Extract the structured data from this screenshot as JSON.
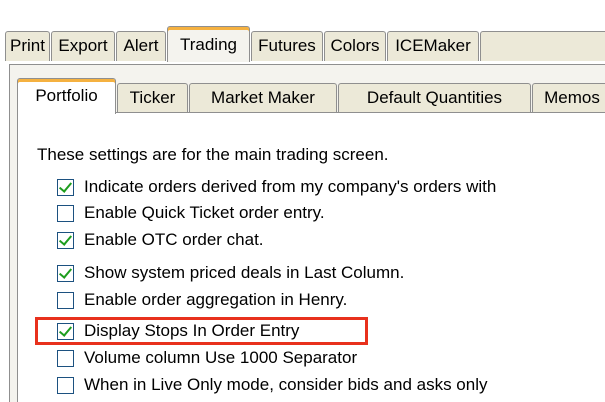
{
  "outer_tabs": [
    {
      "label": "Print",
      "active": false
    },
    {
      "label": "Export",
      "active": false
    },
    {
      "label": "Alert",
      "active": false
    },
    {
      "label": "Trading",
      "active": true
    },
    {
      "label": "Futures",
      "active": false
    },
    {
      "label": "Colors",
      "active": false
    },
    {
      "label": "ICEMaker",
      "active": false
    },
    {
      "label": "",
      "active": false
    }
  ],
  "inner_tabs": [
    {
      "label": "Portfolio",
      "active": true
    },
    {
      "label": "Ticker",
      "active": false
    },
    {
      "label": "Market Maker",
      "active": false
    },
    {
      "label": "Default Quantities",
      "active": false
    },
    {
      "label": "Memos",
      "active": false
    }
  ],
  "intro_text": "These settings are for the main trading screen.",
  "options": [
    {
      "label": "Indicate orders derived from my company's orders with",
      "checked": true
    },
    {
      "label": "Enable Quick Ticket order entry.",
      "checked": false
    },
    {
      "label": "Enable OTC order chat.",
      "checked": true
    },
    {
      "label": "Show system priced deals in Last Column.",
      "checked": true
    },
    {
      "label": "Enable order aggregation in Henry.",
      "checked": false
    },
    {
      "label": "Display Stops In Order Entry",
      "checked": true
    },
    {
      "label": "Volume column Use 1000 Separator",
      "checked": false
    },
    {
      "label": "When in Live Only mode, consider bids and asks only",
      "checked": false
    }
  ],
  "colors": {
    "active_tab_accent": "#f5b140",
    "highlight_box": "#e8311d",
    "checkmark": "#1e9d1e"
  }
}
